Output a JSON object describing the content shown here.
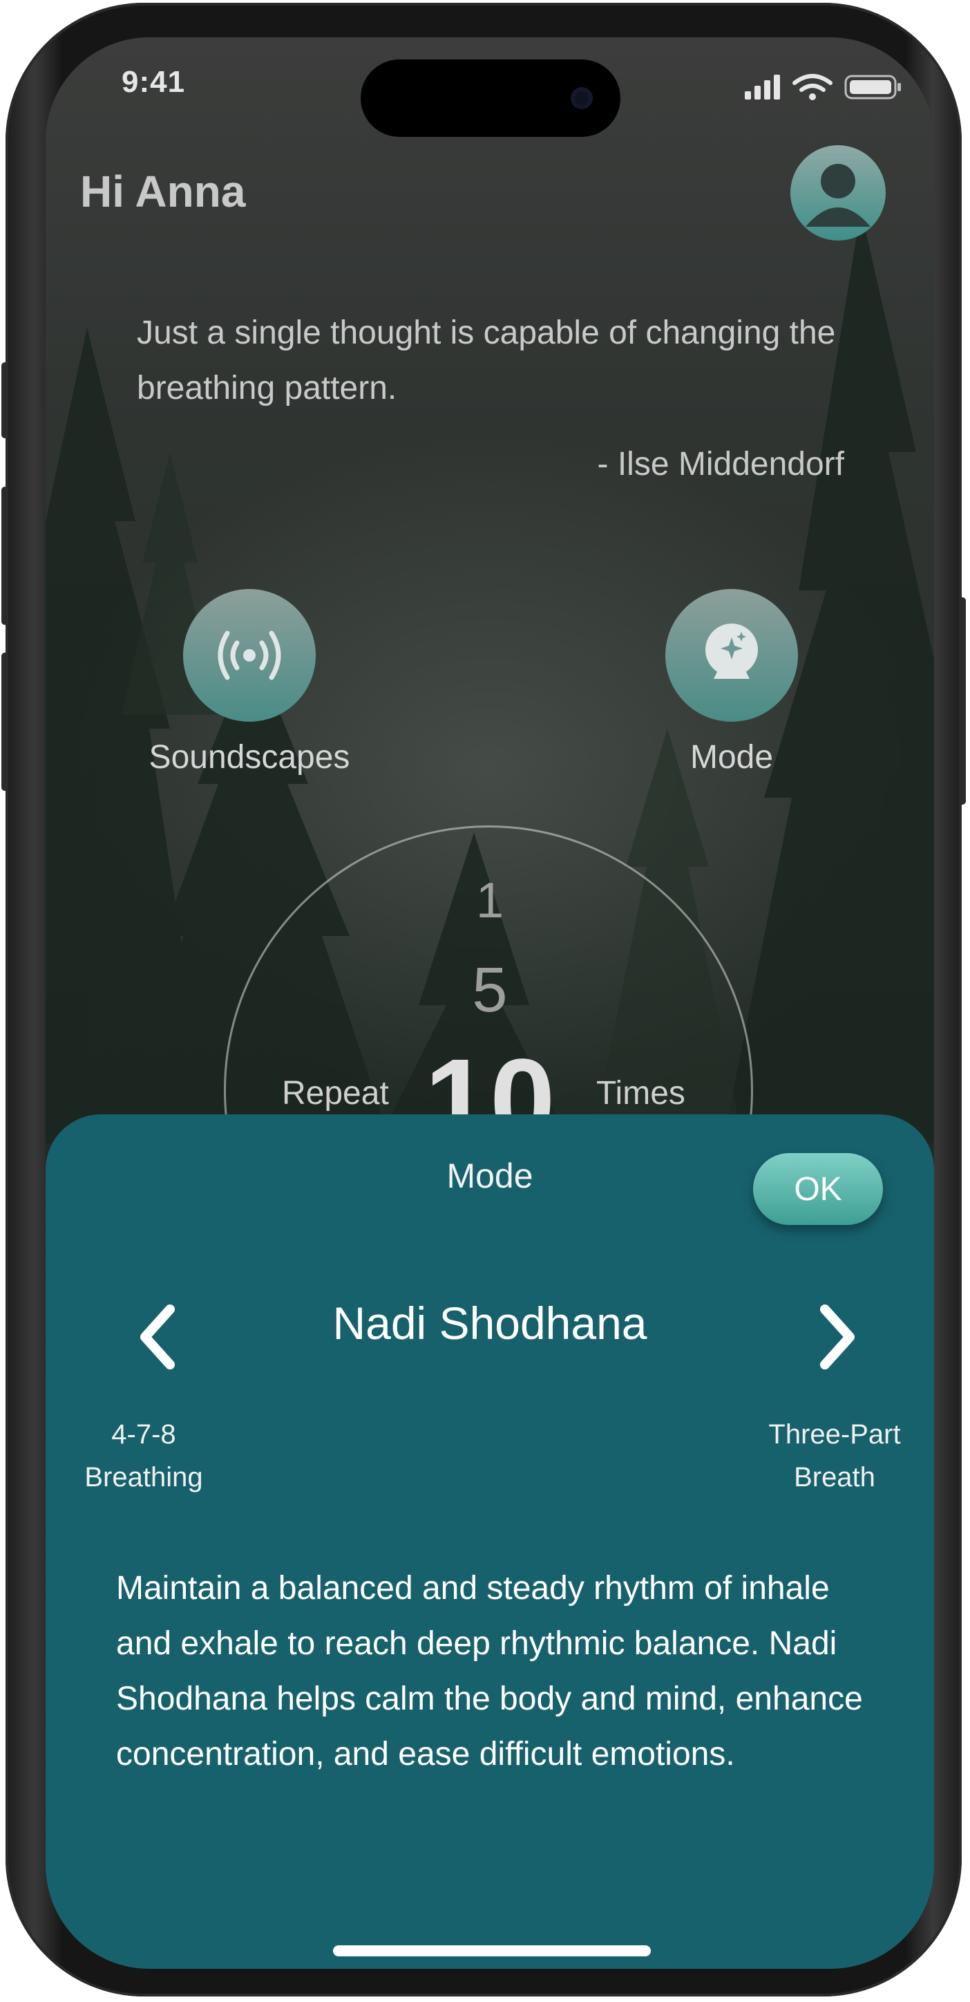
{
  "status": {
    "time": "9:41"
  },
  "header": {
    "greeting": "Hi Anna"
  },
  "quote": {
    "text": "Just a single thought is capable of changing the breathing pattern.",
    "author": "- Ilse Middendorf"
  },
  "actions": {
    "soundscapes_label": "Soundscapes",
    "mode_label": "Mode"
  },
  "repeat": {
    "prefix": "Repeat",
    "suffix": "Times",
    "options": [
      "1",
      "5",
      "10"
    ]
  },
  "sheet": {
    "title": "Mode",
    "ok_label": "OK",
    "current": "Nadi Shodhana",
    "prev_line1": "4-7-8",
    "prev_line2": "Breathing",
    "next_line1": "Three-Part",
    "next_line2": "Breath",
    "description": "Maintain a balanced and steady rhythm of inhale and exhale to reach deep rhythmic balance. Nadi Shodhana helps calm the body and mind, enhance concentration, and ease difficult emotions."
  },
  "colors": {
    "sheet": "#17616d",
    "accent": "#3f9f94"
  },
  "icons": [
    "person-icon",
    "broadcast-icon",
    "crystal-ball-icon",
    "chevron-left-icon",
    "chevron-right-icon"
  ]
}
